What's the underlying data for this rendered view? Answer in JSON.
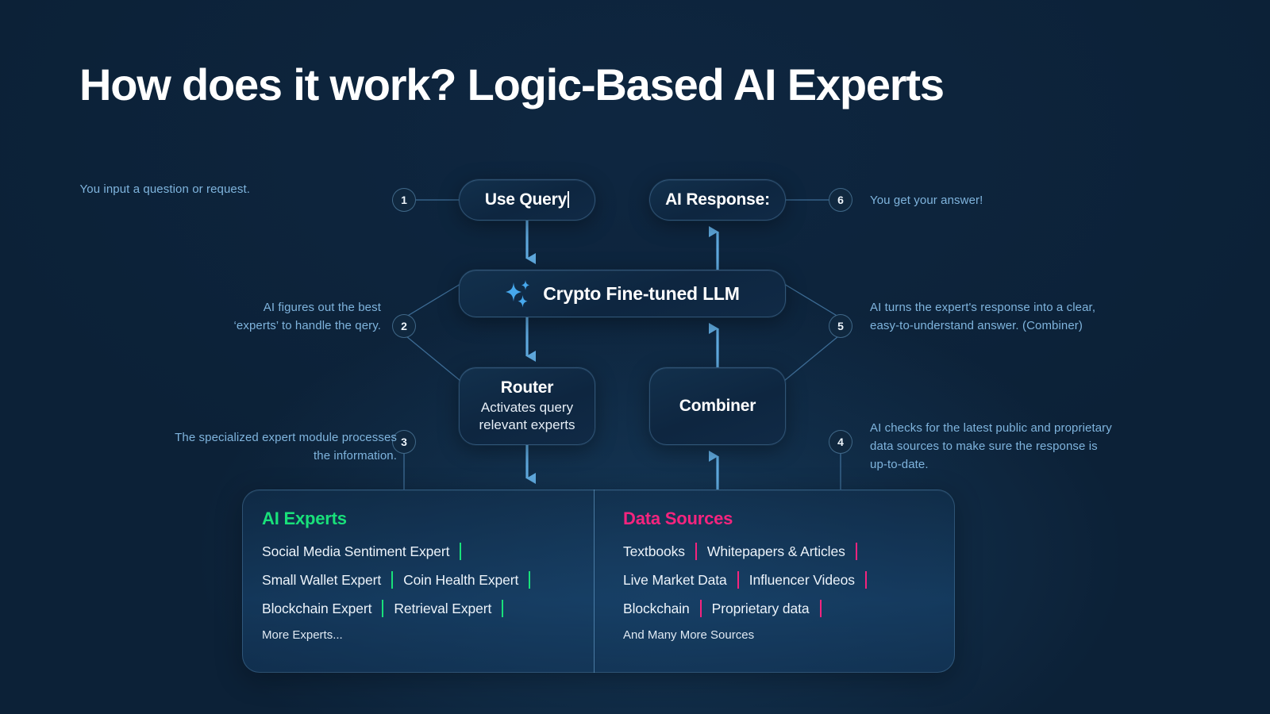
{
  "title": "How does it work? Logic-Based AI Experts",
  "colors": {
    "background": "#0c2137",
    "connector": "#5fa9de",
    "thin_line": "#3d6c95",
    "annotation_text": "#7fb4dd",
    "experts_accent": "#19e07a",
    "sources_accent": "#f5247e"
  },
  "nodes": {
    "use_query": {
      "title": "Use Query",
      "caret": true
    },
    "ai_response": {
      "title": "AI Response:"
    },
    "llm": {
      "title": "Crypto Fine-tuned LLM",
      "icon": "sparkles-icon"
    },
    "router": {
      "title": "Router",
      "subtitle": "Activates query relevant experts"
    },
    "combiner": {
      "title": "Combiner"
    }
  },
  "steps": [
    {
      "number": "1",
      "text": "You input a question or request."
    },
    {
      "number": "2",
      "text": "AI figures out the best ‘experts’ to handle the qery."
    },
    {
      "number": "3",
      "text": "The specialized expert module processes the information."
    },
    {
      "number": "4",
      "text": "AI checks for the latest  public and proprietary data sources to make sure the response is up-to-date."
    },
    {
      "number": "5",
      "text": "AI turns the expert's response into a clear, easy-to-understand answer. (Combiner)"
    },
    {
      "number": "6",
      "text": "You get your answer!"
    }
  ],
  "panel": {
    "experts": {
      "heading": "AI Experts",
      "rows": [
        [
          "Social Media Sentiment Expert"
        ],
        [
          "Small Wallet Expert",
          "Coin Health Expert"
        ],
        [
          "Blockchain Expert",
          "Retrieval Expert"
        ]
      ],
      "footer": "More Experts..."
    },
    "sources": {
      "heading": "Data Sources",
      "rows": [
        [
          "Textbooks",
          "Whitepapers & Articles"
        ],
        [
          "Live Market Data",
          "Influencer Videos"
        ],
        [
          "Blockchain",
          "Proprietary data"
        ]
      ],
      "footer": "And Many More Sources"
    }
  }
}
